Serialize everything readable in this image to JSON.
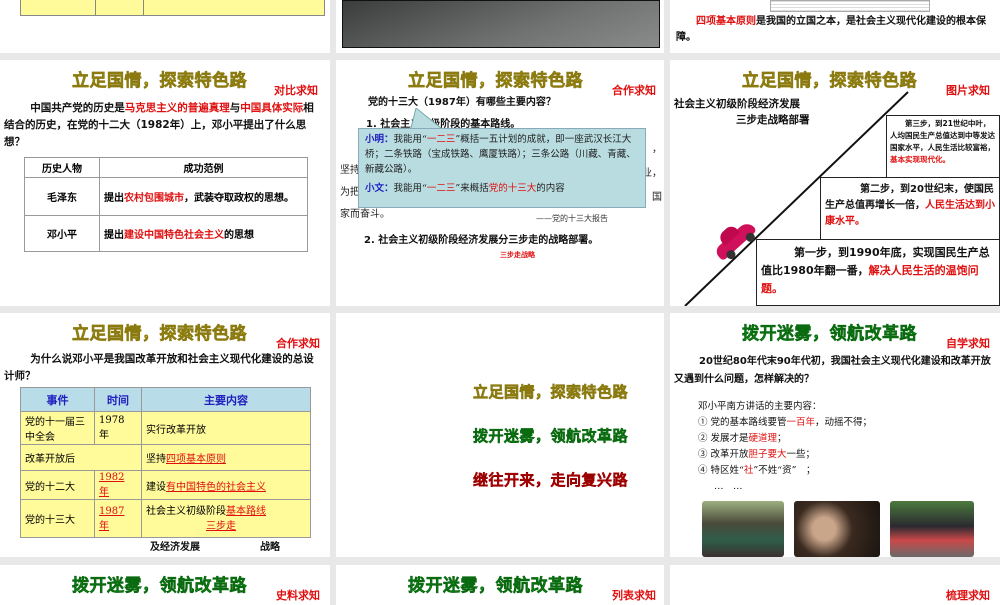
{
  "slides": {
    "top_right": {
      "red": "四项基本原则",
      "text": "是我国的立国之本，是社会主义现代化建设的根本保障。"
    },
    "s1": {
      "title": "立足国情，探索特色路",
      "tag": "对比求知",
      "q_pre": "中国共产党的历史是",
      "q_red1": "马克思主义的普遍真理",
      "q_mid": "与",
      "q_red2": "中国具体实际",
      "q_post": "相结合的历史，在党的十二大（1982年）上，邓小平提出了什么思想？",
      "headers": [
        "历史人物",
        "成功范例"
      ],
      "rows": [
        {
          "person": "毛泽东",
          "pre": "提出",
          "red": "农村包围城市",
          "post": "，武装夺取政权的思想。"
        },
        {
          "person": "邓小平",
          "pre": "提出",
          "red": "建设中国特色社会主义",
          "post": "的思想"
        }
      ]
    },
    "s2": {
      "title": "立足国情，探索特色路",
      "tag": "合作求知",
      "question": "党的十三大（1987年）有哪些主要内容？",
      "point1": "1. 社会主义初级阶段的基本路线。",
      "bg_left": [
        "坚持",
        "为把",
        "家而奋斗。"
      ],
      "bg_right": [
        "，",
        "业，",
        "国"
      ],
      "callout_ming_label": "小明：",
      "callout_ming_pre": "我能用“",
      "callout_ming_red": "一二三",
      "callout_ming_post": "”概括一五计划的成就，即一座武汉长江大桥；二条铁路（宝成铁路、鹰厦铁路）；三条公路（川藏、青藏、新藏公路）。",
      "callout_wen_label": "小文：",
      "callout_wen_pre": "我能用“",
      "callout_wen_red": "一二三",
      "callout_wen_mid": "”来概括",
      "callout_wen_red2": "党的十三大",
      "callout_wen_post": "的内容",
      "source": "——党的十三大报告",
      "point2": "2. 社会主义初级阶段经济发展分三步走的战略部署。",
      "link": "三步走战略"
    },
    "s3": {
      "title": "立足国情，探索特色路",
      "tag": "图片求知",
      "heading1": "社会主义初级阶段经济发展",
      "heading2": "三步走战略部署",
      "step3": "第三步，到21世纪中叶，人均国民生产总值达到中等发达国家水平，人民生活比较富裕，",
      "step3_red": "基本实现现代化。",
      "step2": "第二步，到20世纪末，使国民生产总值再增长一倍，",
      "step2_red": "人民生活达到小康水平。",
      "step1": "第一步，到1990年底，实现国民生产总值比1980年翻一番，",
      "step1_red": "解决人民生活的温饱问题。"
    },
    "s4": {
      "title": "立足国情，探索特色路",
      "tag": "合作求知",
      "question": "为什么说邓小平是我国改革开放和社会主义现代化建设的总设计师？",
      "headers": [
        "事件",
        "时间",
        "主要内容"
      ],
      "rows": [
        {
          "event": "党的十一届三中全会",
          "time": "1978 年",
          "pre": "实行改革开放",
          "red": ""
        },
        {
          "event": "改革开放后",
          "time": "",
          "pre": "坚持",
          "red": "四项基本原则"
        },
        {
          "event": "党的十二大",
          "time": "1982 年",
          "pre": "建设",
          "red": "有中国特色的社会主义"
        },
        {
          "event": "党的十三大",
          "time": "1987 年",
          "pre": "社会主义初级阶段",
          "red": "基本路线",
          "red2": "三步走"
        }
      ],
      "cut_text": "及经济发展　　　　　　战略"
    },
    "s5": {
      "line1": "立足国情，探索特色路",
      "line2": "拨开迷雾，领航改革路",
      "line3": "继往开来，走向复兴路"
    },
    "s6": {
      "title": "拨开迷雾，领航改革路",
      "tag": "自学求知",
      "question": "20世纪80年代末90年代初，我国社会主义现代化建设和改革开放又遇到什么问题，怎样解决的？",
      "list_title": "邓小平南方讲话的主要内容：",
      "items": [
        {
          "pre": "① 党的基本路线要管",
          "red": "一百年",
          "post": "，动摇不得；"
        },
        {
          "pre": "② 发展才是",
          "red": "硬道理",
          "post": "；"
        },
        {
          "pre": "③ 改革开放",
          "red": "胆子要大",
          "post": "一些；"
        },
        {
          "pre": "④ 特区姓“",
          "red": "社",
          "post": "”不姓“资”　；"
        }
      ],
      "ellipsis": "…　…"
    },
    "s7": {
      "title": "拨开迷雾，领航改革路",
      "tag": "史料求知"
    },
    "s8": {
      "title": "拨开迷雾，领航改革路",
      "tag": "列表求知"
    },
    "s9": {
      "tag": "梳理求知"
    }
  }
}
